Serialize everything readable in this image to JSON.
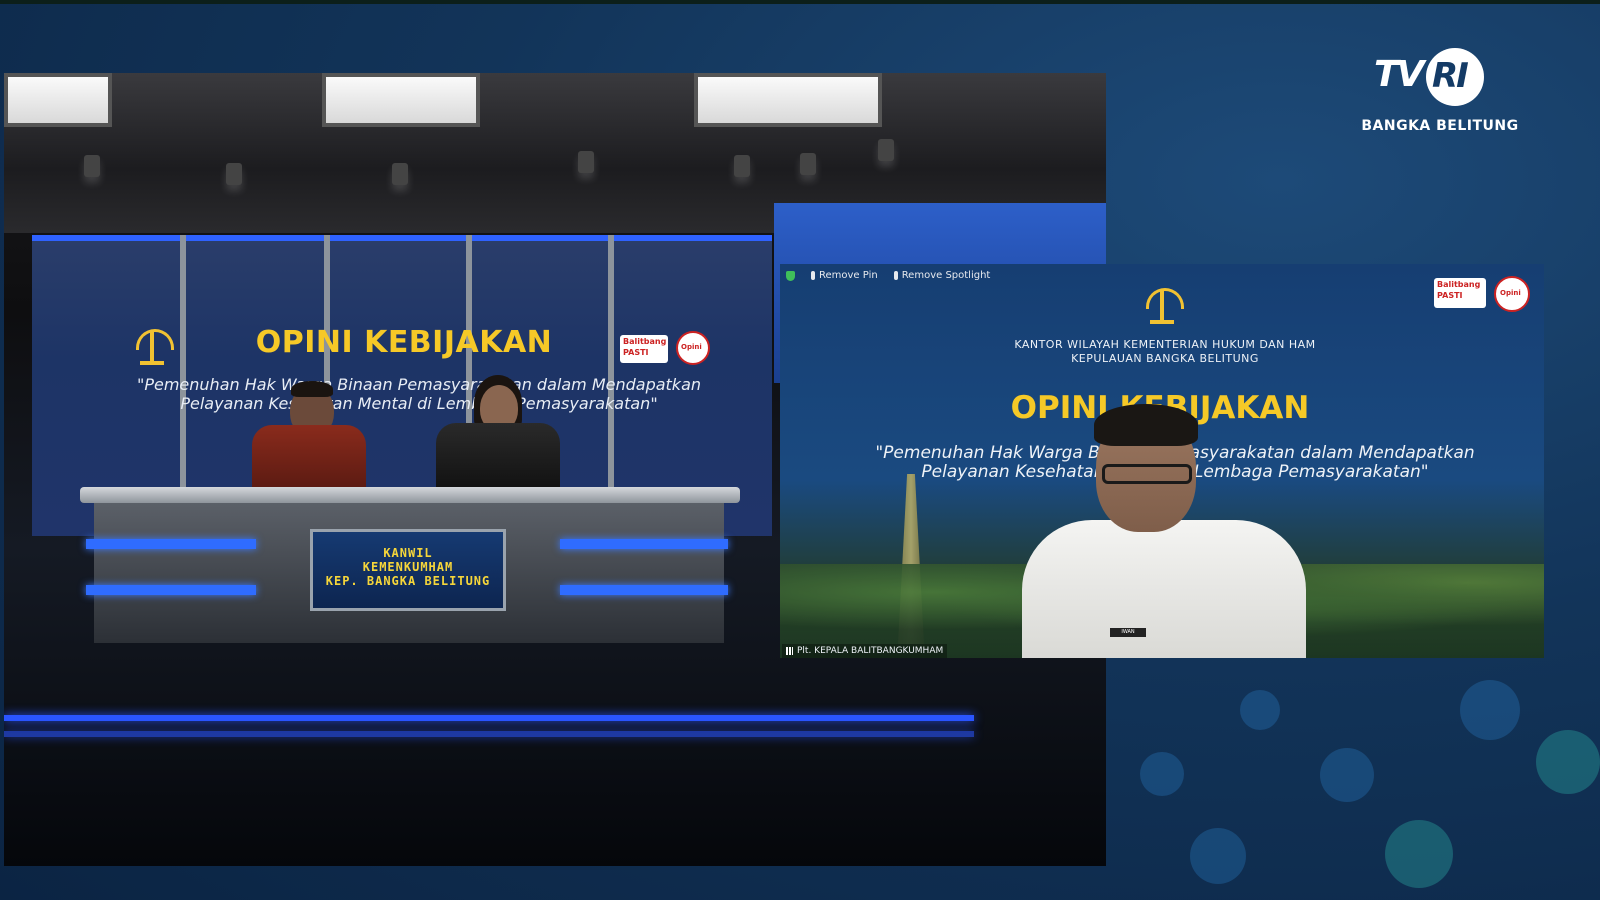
{
  "channel": {
    "logo_tv": "TV",
    "logo_ri": "RI",
    "region": "BANGKA BELITUNG"
  },
  "studio": {
    "title": "OPINI KEBIJAKAN",
    "quote": "\"Pemenuhan Hak Warga Binaan Pemasyarakatan dalam Mendapatkan Pelayanan Kesehatan Mental di Lembaga Pemasyarakatan\"",
    "desk_text_line1": "KANWIL",
    "desk_text_line2": "KEMENKUMHAM",
    "desk_text_line3": "KEP. BANGKA BELITUNG",
    "sponsor_left": "Balitbang",
    "sponsor_left_sub": "PASTI",
    "sponsor_right": "Opini"
  },
  "call": {
    "toolbar": {
      "remove_pin": "Remove Pin",
      "remove_spotlight": "Remove Spotlight"
    },
    "org_line1": "KANTOR WILAYAH KEMENTERIAN HUKUM DAN HAM",
    "org_line2": "KEPULAUAN BANGKA BELITUNG",
    "title": "OPINI KEBIJAKAN",
    "quote": "\"Pemenuhan Hak Warga Binaan Pemasyarakatan dalam Mendapatkan Pelayanan Kesehatan Mental di Lembaga Pemasyarakatan\"",
    "participant_name": "Plt. KEPALA BALITBANGKUMHAM",
    "nametag": "IWAN",
    "sponsor_left": "Balitbang",
    "sponsor_left_sub": "PASTI",
    "sponsor_right": "Opini"
  },
  "colors": {
    "accent_yellow": "#f6c927",
    "studio_blue": "#2f62ff",
    "background": "#123459"
  }
}
